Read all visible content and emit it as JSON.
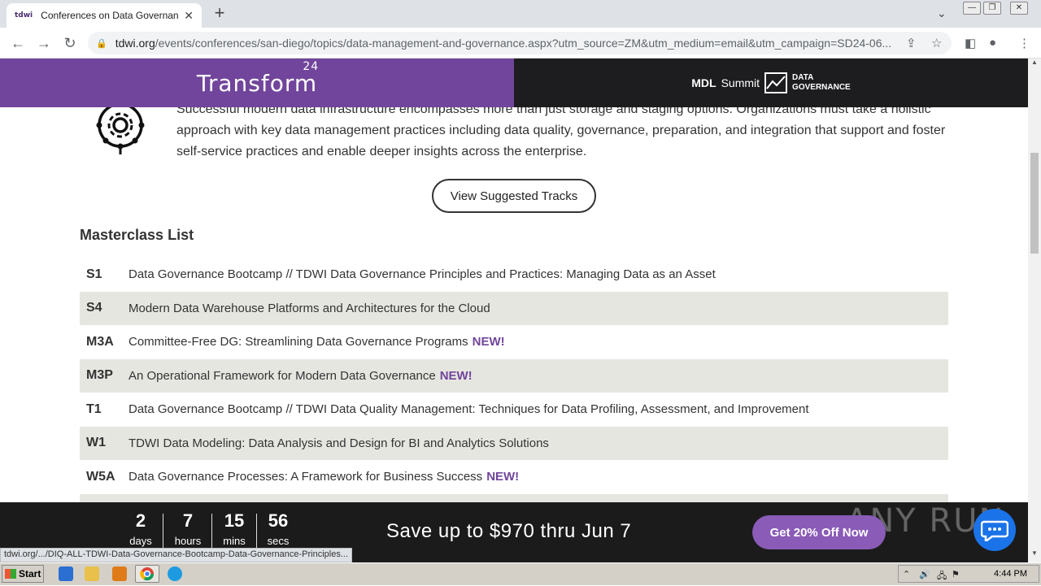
{
  "browser": {
    "tab_title": "Conferences on Data Governance &",
    "tab_favicon": "tdwi",
    "url_host": "tdwi.org",
    "url_path": "/events/conferences/san-diego/topics/data-management-and-governance.aspx?utm_source=ZM&utm_medium=email&utm_campaign=SD24-06...",
    "status_link": "tdwi.org/.../DIQ-ALL-TDWI-Data-Governance-Bootcamp-Data-Governance-Principles..."
  },
  "banner": {
    "left_logo": "Transform",
    "left_logo_sup": "24",
    "right_mdl": "MDL",
    "right_summit": "Summit",
    "right_dg_line1": "DATA",
    "right_dg_line2": "GOVERNANCE"
  },
  "intro": {
    "partial_line": "Successful modern data infrastructure encompasses more than just storage and staging options. Organizations must take a holistic",
    "text": "approach with key data management practices including data quality, governance, preparation, and integration that support and foster self-service practices and enable deeper insights across the enterprise."
  },
  "tracks_button": "View Suggested Tracks",
  "masterclass": {
    "title": "Masterclass List",
    "rows": [
      {
        "code": "S1",
        "title": "Data Governance Bootcamp // TDWI Data Governance Principles and Practices: Managing Data as an Asset",
        "new": ""
      },
      {
        "code": "S4",
        "title": "Modern Data Warehouse Platforms and Architectures for the Cloud",
        "new": ""
      },
      {
        "code": "M3A",
        "title": "Committee-Free DG: Streamlining Data Governance Programs",
        "new": "NEW!"
      },
      {
        "code": "M3P",
        "title": "An Operational Framework for Modern Data Governance",
        "new": "NEW!"
      },
      {
        "code": "T1",
        "title": "Data Governance Bootcamp // TDWI Data Quality Management: Techniques for Data Profiling, Assessment, and Improvement",
        "new": ""
      },
      {
        "code": "W1",
        "title": "TDWI Data Modeling: Data Analysis and Design for BI and Analytics Solutions",
        "new": ""
      },
      {
        "code": "W5A",
        "title": "Data Governance Processes: A Framework for Business Success",
        "new": "NEW!"
      }
    ]
  },
  "promo": {
    "countdown": [
      {
        "num": "2",
        "label": "days"
      },
      {
        "num": "7",
        "label": "hours"
      },
      {
        "num": "15",
        "label": "mins"
      },
      {
        "num": "56",
        "label": "secs"
      }
    ],
    "save_text": "Save up to $970 thru Jun 7",
    "button": "Get 20% Off Now",
    "watermark": "ANY RUN"
  },
  "taskbar": {
    "start": "Start",
    "clock": "4:44 PM"
  },
  "colors": {
    "purple": "#71459b",
    "dark": "#1d1d1f",
    "row_alt": "#e6e6e1",
    "new_label": "#71459b"
  }
}
